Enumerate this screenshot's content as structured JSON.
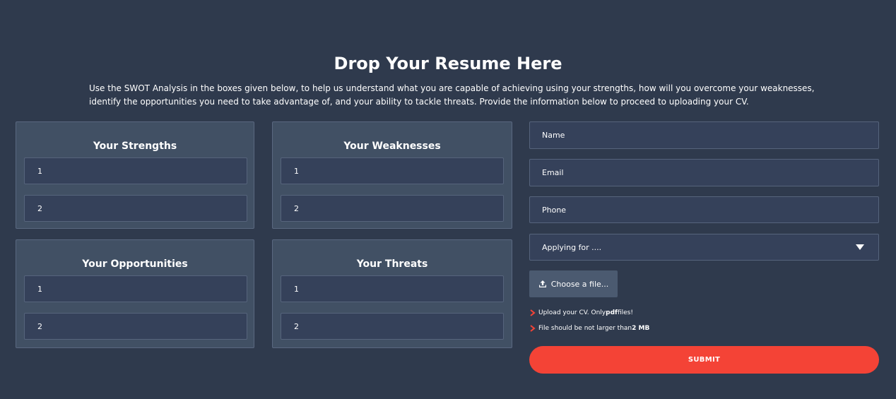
{
  "header": {
    "title": "Drop Your Resume Here",
    "intro": "Use the SWOT Analysis in the boxes given below, to help us understand what you are capable of achieving using your strengths, how will you overcome your weaknesses, identify the opportunities you need to take advantage of, and your ability to tackle threats. Provide the information below to proceed to uploading your CV."
  },
  "swot": {
    "strengths": {
      "title": "Your Strengths",
      "placeholder_1": "1",
      "placeholder_2": "2"
    },
    "weaknesses": {
      "title": "Your Weaknesses",
      "placeholder_1": "1",
      "placeholder_2": "2"
    },
    "opportunities": {
      "title": "Your Opportunities",
      "placeholder_1": "1",
      "placeholder_2": "2"
    },
    "threats": {
      "title": "Your Threats",
      "placeholder_1": "1",
      "placeholder_2": "2"
    }
  },
  "form": {
    "name_placeholder": "Name",
    "email_placeholder": "Email",
    "phone_placeholder": "Phone",
    "applying_for_value": "Applying for ....",
    "choose_file_label": "Choose a file...",
    "note_1_prefix": "Upload your CV. Only ",
    "note_1_bold": "pdf",
    "note_1_suffix": " files!",
    "note_2_prefix": "File should be not larger than ",
    "note_2_bold": "2 MB",
    "submit_label": "SUBMIT"
  },
  "colors": {
    "background": "#2f3a4d",
    "panel": "#415064",
    "field": "#35415a",
    "accent": "#f44336"
  },
  "icons": {
    "dropdown": "caret-down-icon",
    "upload": "upload-icon",
    "note_bullet": "chevron-right-icon"
  }
}
